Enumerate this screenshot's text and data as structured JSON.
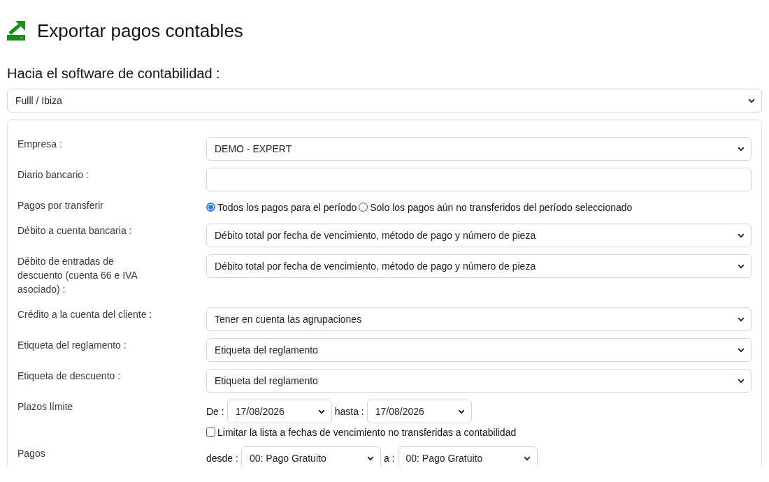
{
  "header": {
    "title": "Exportar pagos contables"
  },
  "software": {
    "label": "Hacia el software de contabilidad :",
    "value": "Fulll / Ibiza"
  },
  "fields": [
    {
      "kind": "select",
      "label": "Empresa :",
      "value": "DEMO - EXPERT"
    },
    {
      "kind": "input",
      "label": "Diario bancario :"
    },
    {
      "kind": "radio",
      "label": "Pagos por transferir",
      "options": [
        {
          "label": "Todos los pagos para el período",
          "selected": true
        },
        {
          "label": "Solo los pagos aún no transferidos del período seleccionado",
          "selected": false
        }
      ]
    },
    {
      "kind": "select",
      "label": "Débito a cuenta bancaria :",
      "value": "Débito total por fecha de vencimiento, método de pago y número de pieza"
    },
    {
      "kind": "select",
      "label": "Débito de entradas de descuento (cuenta 66 e IVA asociado) :",
      "value": "Débito total por fecha de vencimiento, método de pago y número de pieza"
    },
    {
      "kind": "select",
      "label": "Crédito a la cuenta del cliente :",
      "value": "Tener en cuenta las agrupaciones"
    },
    {
      "kind": "select",
      "label": "Etiqueta del reglamento :",
      "value": "Etiqueta del reglamento"
    },
    {
      "kind": "select",
      "label": "Etiqueta de descuento :",
      "value": "Etiqueta del reglamento"
    },
    {
      "kind": "date_range",
      "label": "Plazos límite",
      "from_label": "De :",
      "from": "17/08/2026",
      "to_label": "hasta :",
      "to": "17/08/2026",
      "checkbox": {
        "label": "Limitar la lista a fechas de vencimiento no transferidas a contabilidad",
        "checked": false
      }
    },
    {
      "kind": "code_range",
      "label": "Pagos",
      "from_label": "desde :",
      "from": "00: Pago Gratuito",
      "to_label": "a :",
      "to": "00: Pago Gratuito"
    }
  ]
}
